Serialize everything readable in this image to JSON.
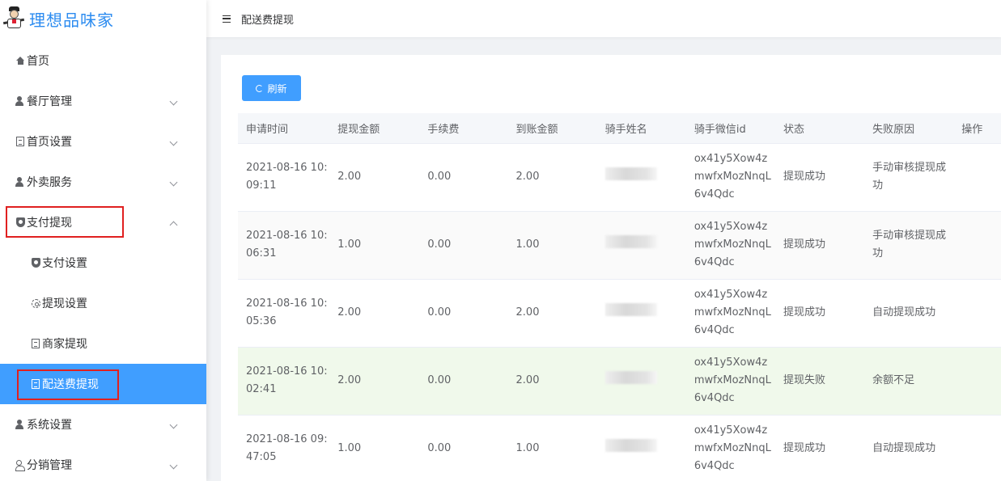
{
  "brand": {
    "title": "理想品味家"
  },
  "sidebar": {
    "items": [
      {
        "label": "首页",
        "icon": "home-icon"
      },
      {
        "label": "餐厅管理",
        "icon": "person-icon",
        "expandable": true
      },
      {
        "label": "首页设置",
        "icon": "document-icon",
        "expandable": true
      },
      {
        "label": "外卖服务",
        "icon": "person-icon",
        "expandable": true
      },
      {
        "label": "支付提现",
        "icon": "shield-icon",
        "expandable": true,
        "highlighted": true
      },
      {
        "label": "支付设置",
        "icon": "shield-icon",
        "sub": true
      },
      {
        "label": "提现设置",
        "icon": "gear-icon",
        "sub": true
      },
      {
        "label": "商家提现",
        "icon": "document-icon",
        "sub": true
      },
      {
        "label": "配送费提现",
        "icon": "document-icon",
        "sub": true,
        "active": true,
        "highlighted": true
      },
      {
        "label": "系统设置",
        "icon": "person-icon",
        "expandable": true
      },
      {
        "label": "分销管理",
        "icon": "people-icon",
        "expandable": true
      }
    ]
  },
  "header": {
    "breadcrumb": "配送费提现"
  },
  "toolbar": {
    "refresh_label": "刷新"
  },
  "table": {
    "columns": [
      "申请时间",
      "提现金额",
      "手续费",
      "到账金额",
      "骑手姓名",
      "骑手微信id",
      "状态",
      "失败原因",
      "操作"
    ],
    "rows": [
      {
        "time": "2021-08-16 10:09:11",
        "amount": "2.00",
        "fee": "0.00",
        "received": "2.00",
        "name": "",
        "wxid": "ox41y5Xow4zmwfxMozNnqL6v4Qdc",
        "status": "提现成功",
        "reason": "手动审核提现成功"
      },
      {
        "time": "2021-08-16 10:06:31",
        "amount": "1.00",
        "fee": "0.00",
        "received": "1.00",
        "name": "",
        "wxid": "ox41y5Xow4zmwfxMozNnqL6v4Qdc",
        "status": "提现成功",
        "reason": "手动审核提现成功"
      },
      {
        "time": "2021-08-16 10:05:36",
        "amount": "2.00",
        "fee": "0.00",
        "received": "2.00",
        "name": "",
        "wxid": "ox41y5Xow4zmwfxMozNnqL6v4Qdc",
        "status": "提现成功",
        "reason": "自动提现成功"
      },
      {
        "time": "2021-08-16 10:02:41",
        "amount": "2.00",
        "fee": "0.00",
        "received": "2.00",
        "name": "",
        "wxid": "ox41y5Xow4zmwfxMozNnqL6v4Qdc",
        "status": "提现失败",
        "reason": "余额不足"
      },
      {
        "time": "2021-08-16 09:47:05",
        "amount": "1.00",
        "fee": "0.00",
        "received": "1.00",
        "name": "",
        "wxid": "ox41y5Xow4zmwfxMozNnqL6v4Qdc",
        "status": "提现成功",
        "reason": "自动提现成功"
      }
    ]
  },
  "colors": {
    "accent": "#409eff",
    "brand": "#2d8cf0",
    "highlight_border": "#e02020",
    "hover_row": "#f0f9eb"
  }
}
